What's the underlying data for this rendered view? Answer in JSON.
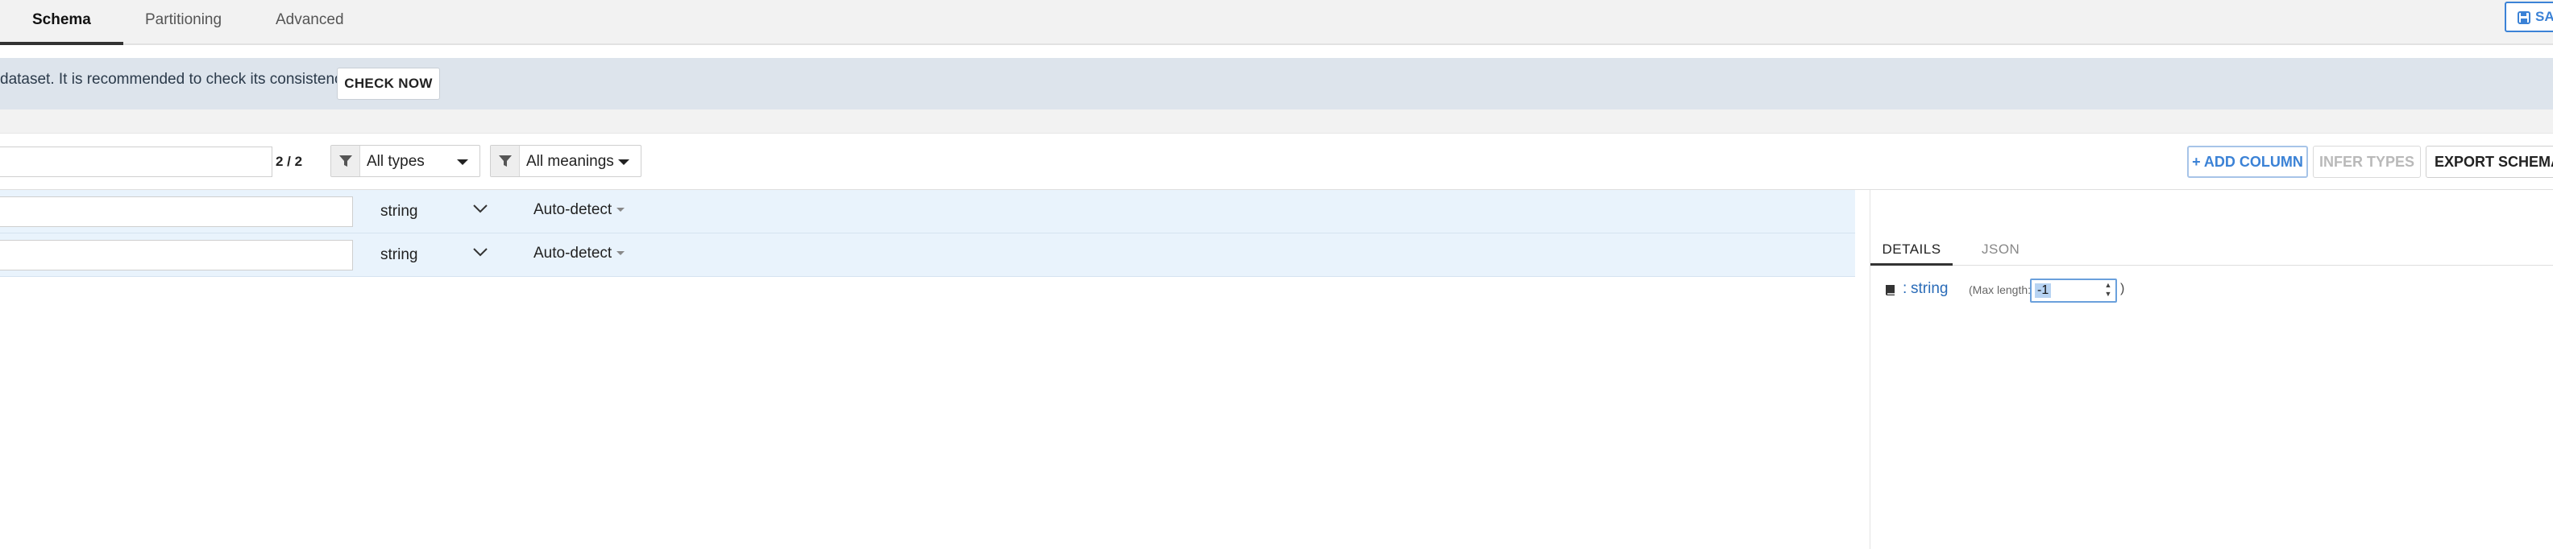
{
  "tabs": [
    {
      "label": "Schema",
      "active": true
    },
    {
      "label": "Partitioning",
      "active": false
    },
    {
      "label": "Advanced",
      "active": false
    }
  ],
  "save_button": {
    "label": "SAVE",
    "icon": "save-icon",
    "color": "#3b82d6"
  },
  "alert": {
    "text": "dataset. It is recommended to check its consistency.",
    "check_button": "CHECK NOW"
  },
  "toolbar": {
    "search_value": "",
    "count": "2 / 2",
    "type_filter": "All types",
    "meaning_filter": "All meanings",
    "add_column": "+ ADD COLUMN",
    "infer_types": "INFER TYPES",
    "export_schema": "EXPORT SCHEMA"
  },
  "rows": [
    {
      "name": "",
      "type": "string",
      "meaning": "Auto-detect"
    },
    {
      "name": "",
      "type": "string",
      "meaning": "Auto-detect"
    }
  ],
  "panel": {
    "tabs": [
      "DETAILS",
      "JSON"
    ],
    "colon": ":",
    "type": "string",
    "max_length_label": "(Max length:",
    "max_length_value": "-1",
    "close_paren": ")"
  },
  "colors": {
    "accent": "#3b82d6",
    "row_bg": "#e9f3fc",
    "alert_bg": "#dde4ec",
    "disabled_text": "#b9b9b9"
  }
}
